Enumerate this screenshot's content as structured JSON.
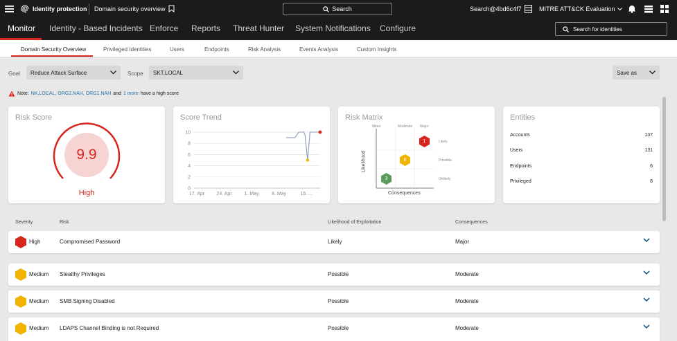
{
  "topbar": {
    "app_title": "Identity protection",
    "page_title": "Domain security overview",
    "search_label": "Search",
    "user_search": "Search@4bd6c4f7",
    "mitre": "MITRE ATT&CK Evaluation"
  },
  "nav": {
    "items": [
      "Monitor",
      "Identity - Based Incidents",
      "Enforce",
      "Reports",
      "Threat Hunter",
      "System Notifications",
      "Configure"
    ],
    "search_placeholder": "Search for identities"
  },
  "subnav": {
    "tabs": [
      "Domain Security Overview",
      "Privileged Identities",
      "Users",
      "Endpoints",
      "Risk Analysis",
      "Events Analysis",
      "Custom Insights"
    ]
  },
  "filters": {
    "goal_label": "Goal",
    "goal_value": "Reduce Attack Surface",
    "scope_label": "Scope",
    "scope_value": "SKT.LOCAL",
    "save_label": "Save as"
  },
  "note": {
    "prefix": "Note:",
    "domains": "NK.LOCAL, ORG2.NAH, ORG1.NAH",
    "and": "and",
    "more": "1 more",
    "suffix": "have a high score"
  },
  "risk_score": {
    "title": "Risk Score",
    "value": "9.9",
    "level": "High",
    "score_max": 10
  },
  "score_trend": {
    "title": "Score Trend",
    "chart_data": {
      "type": "line",
      "x": [
        "17. Apr",
        "24. Apr",
        "1. May",
        "8. May",
        "15. ..."
      ],
      "y_ticks": [
        0,
        2,
        4,
        6,
        8,
        10
      ],
      "ylim": [
        0,
        10
      ],
      "grid": true,
      "series": [
        {
          "values": [
            [
              0.73,
              9
            ],
            [
              0.8,
              9
            ],
            [
              0.83,
              10
            ],
            [
              0.87,
              10
            ],
            [
              0.88,
              9.5
            ],
            [
              0.9,
              5
            ],
            [
              0.92,
              10
            ],
            [
              1.0,
              10
            ]
          ]
        }
      ]
    }
  },
  "risk_matrix": {
    "title": "Risk Matrix",
    "cols": [
      "Minor",
      "Moderate",
      "Major"
    ],
    "rows": [
      "Likely",
      "Possible",
      "Unlikely"
    ],
    "xlabel": "Consequences",
    "ylabel": "Likelihood",
    "cells": [
      {
        "count": "1",
        "col": 2,
        "row": 0,
        "color": "#d7261e"
      },
      {
        "count": "6",
        "col": 1,
        "row": 1,
        "color": "#f0b400"
      },
      {
        "count": "3",
        "col": 0,
        "row": 2,
        "color": "#5a9a5a"
      }
    ]
  },
  "entities": {
    "title": "Entities",
    "items": [
      {
        "label": "Accounts",
        "count": "137"
      },
      {
        "label": "Users",
        "count": "131"
      },
      {
        "label": "Endpoints",
        "count": "6"
      },
      {
        "label": "Privileged",
        "count": "8"
      }
    ]
  },
  "table": {
    "headers": [
      "Severity",
      "Risk",
      "Likelihood of Exploitation",
      "Consequences"
    ],
    "rows": [
      {
        "severity": "High",
        "color": "#d7261e",
        "risk": "Compromised Password",
        "likelihood": "Likely",
        "consequences": "Major"
      },
      {
        "severity": "Medium",
        "color": "#f0b400",
        "risk": "Stealthy Privileges",
        "likelihood": "Possible",
        "consequences": "Moderate"
      },
      {
        "severity": "Medium",
        "color": "#f0b400",
        "risk": "SMB Signing Disabled",
        "likelihood": "Possible",
        "consequences": "Moderate"
      },
      {
        "severity": "Medium",
        "color": "#f0b400",
        "risk": "LDAPS Channel Binding is not Required",
        "likelihood": "Possible",
        "consequences": "Moderate"
      }
    ]
  },
  "colors": {
    "accent_red": "#d7261e",
    "medium_yellow": "#f0b400",
    "low_green": "#5a9a5a",
    "bar_dark": "#1b1b1b"
  }
}
